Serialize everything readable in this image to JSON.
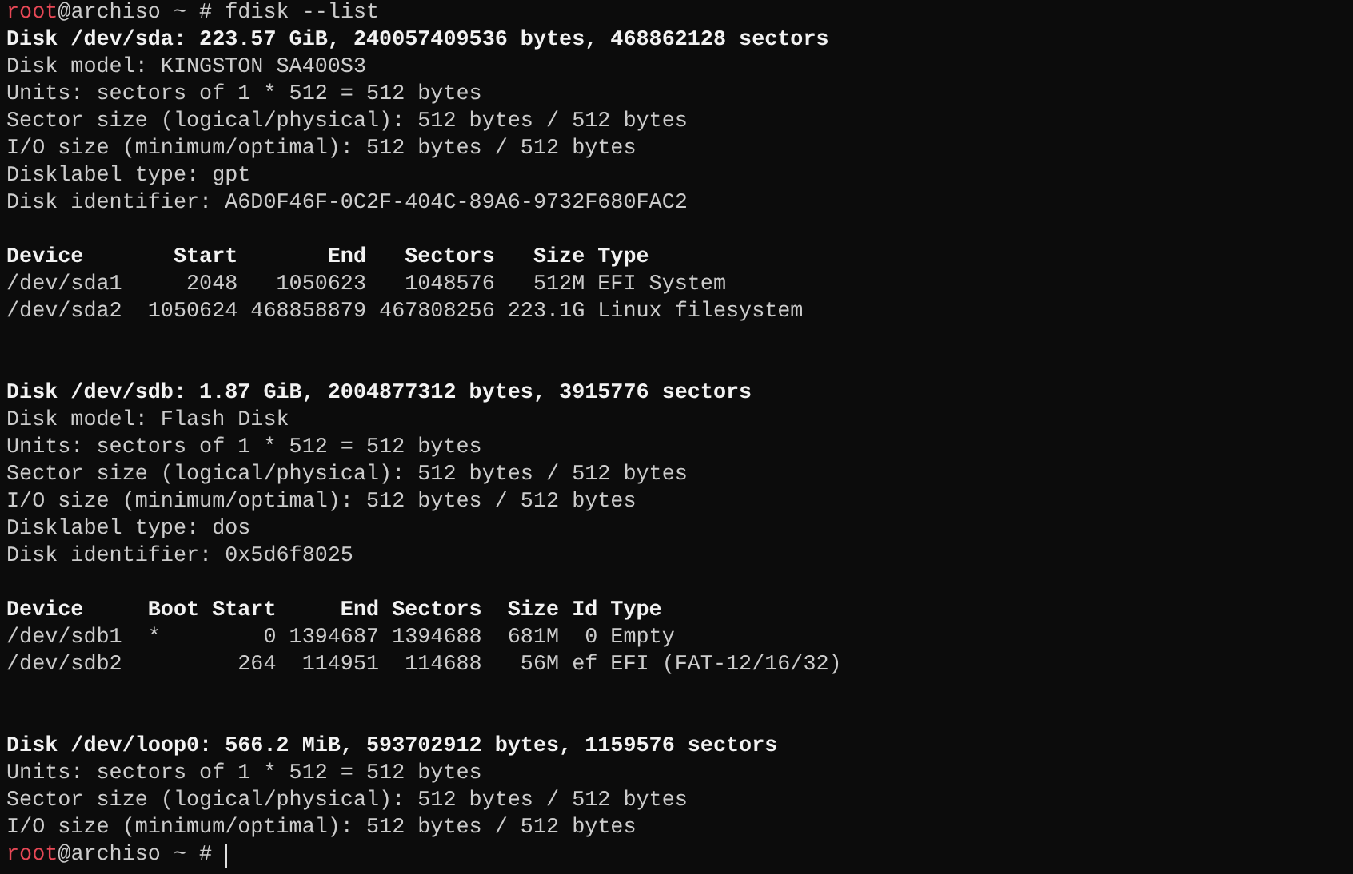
{
  "terminal": {
    "lines": [
      {
        "kind": "prompt",
        "user": "root",
        "host": "@archiso ~ # ",
        "command": "fdisk --list",
        "cursor": false
      },
      {
        "kind": "heading",
        "text": "Disk /dev/sda: 223.57 GiB, 240057409536 bytes, 468862128 sectors"
      },
      {
        "kind": "output",
        "text": "Disk model: KINGSTON SA400S3"
      },
      {
        "kind": "output",
        "text": "Units: sectors of 1 * 512 = 512 bytes"
      },
      {
        "kind": "output",
        "text": "Sector size (logical/physical): 512 bytes / 512 bytes"
      },
      {
        "kind": "output",
        "text": "I/O size (minimum/optimal): 512 bytes / 512 bytes"
      },
      {
        "kind": "output",
        "text": "Disklabel type: gpt"
      },
      {
        "kind": "output",
        "text": "Disk identifier: A6D0F46F-0C2F-404C-89A6-9732F680FAC2"
      },
      {
        "kind": "blank"
      },
      {
        "kind": "heading",
        "text": "Device       Start       End   Sectors   Size Type"
      },
      {
        "kind": "output",
        "text": "/dev/sda1     2048   1050623   1048576   512M EFI System"
      },
      {
        "kind": "output",
        "text": "/dev/sda2  1050624 468858879 467808256 223.1G Linux filesystem"
      },
      {
        "kind": "blank"
      },
      {
        "kind": "blank"
      },
      {
        "kind": "heading",
        "text": "Disk /dev/sdb: 1.87 GiB, 2004877312 bytes, 3915776 sectors"
      },
      {
        "kind": "output",
        "text": "Disk model: Flash Disk"
      },
      {
        "kind": "output",
        "text": "Units: sectors of 1 * 512 = 512 bytes"
      },
      {
        "kind": "output",
        "text": "Sector size (logical/physical): 512 bytes / 512 bytes"
      },
      {
        "kind": "output",
        "text": "I/O size (minimum/optimal): 512 bytes / 512 bytes"
      },
      {
        "kind": "output",
        "text": "Disklabel type: dos"
      },
      {
        "kind": "output",
        "text": "Disk identifier: 0x5d6f8025"
      },
      {
        "kind": "blank"
      },
      {
        "kind": "heading",
        "text": "Device     Boot Start     End Sectors  Size Id Type"
      },
      {
        "kind": "output",
        "text": "/dev/sdb1  *        0 1394687 1394688  681M  0 Empty"
      },
      {
        "kind": "output",
        "text": "/dev/sdb2         264  114951  114688   56M ef EFI (FAT-12/16/32)"
      },
      {
        "kind": "blank"
      },
      {
        "kind": "blank"
      },
      {
        "kind": "heading",
        "text": "Disk /dev/loop0: 566.2 MiB, 593702912 bytes, 1159576 sectors"
      },
      {
        "kind": "output",
        "text": "Units: sectors of 1 * 512 = 512 bytes"
      },
      {
        "kind": "output",
        "text": "Sector size (logical/physical): 512 bytes / 512 bytes"
      },
      {
        "kind": "output",
        "text": "I/O size (minimum/optimal): 512 bytes / 512 bytes"
      },
      {
        "kind": "prompt",
        "user": "root",
        "host": "@archiso ~ # ",
        "cursor": true
      }
    ]
  }
}
